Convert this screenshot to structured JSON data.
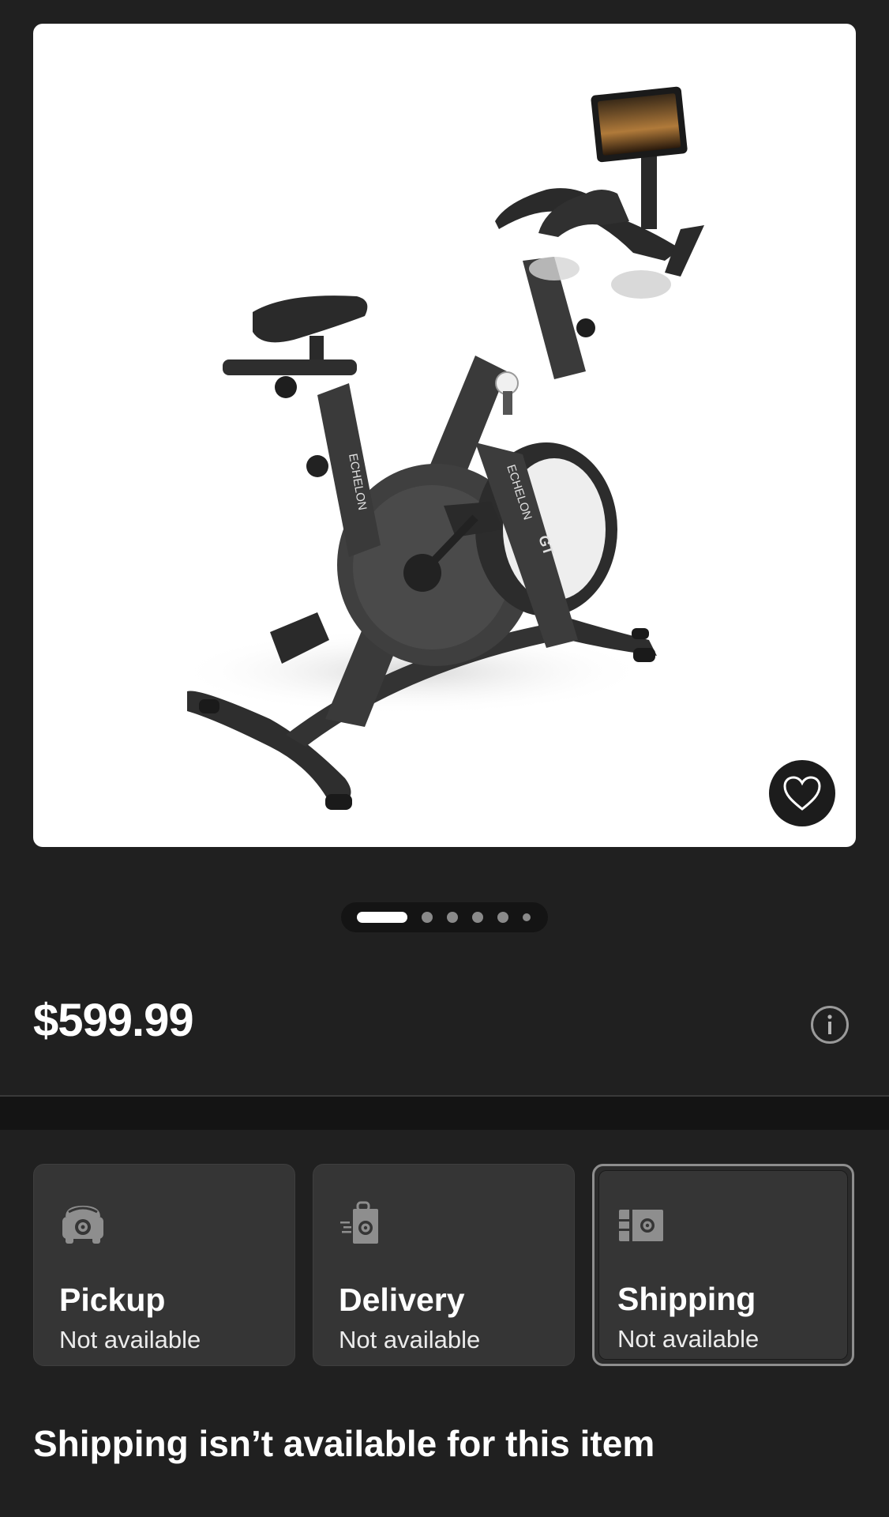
{
  "product": {
    "brand_text_frame": "ECHELON",
    "brand_text_fork": "ECHELON",
    "model_badge": "GT",
    "image_pager": {
      "total": 6,
      "active_index": 0
    }
  },
  "price": {
    "value": "$599.99"
  },
  "fulfillment": {
    "options": [
      {
        "label": "Pickup",
        "status": "Not available",
        "icon": "store-pickup-icon",
        "selected": false
      },
      {
        "label": "Delivery",
        "status": "Not available",
        "icon": "delivery-bag-icon",
        "selected": false
      },
      {
        "label": "Shipping",
        "status": "Not available",
        "icon": "shipping-box-icon",
        "selected": true
      }
    ],
    "message": "Shipping isn’t available for this item"
  },
  "colors": {
    "background": "#202020",
    "card": "#353535",
    "accent_text": "#ffffff"
  }
}
